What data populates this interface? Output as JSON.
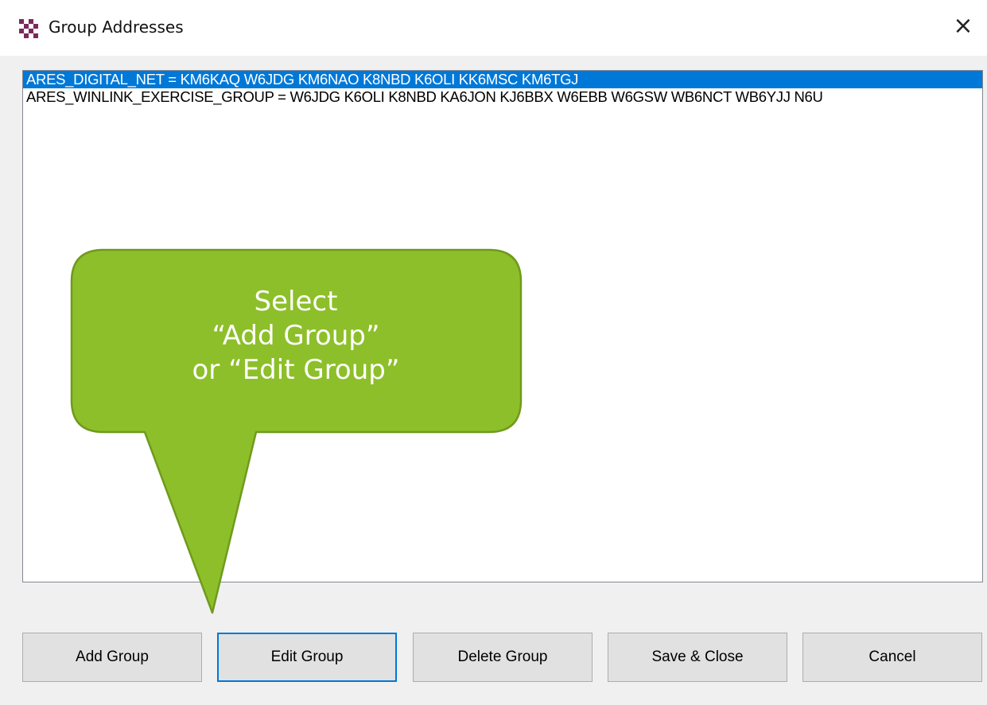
{
  "window": {
    "title": "Group Addresses",
    "close_glyph": "×",
    "icon": "checkered-app-icon"
  },
  "list": {
    "items": [
      {
        "text": "ARES_DIGITAL_NET = KM6KAQ W6JDG KM6NAO K8NBD K6OLI KK6MSC KM6TGJ",
        "selected": true
      },
      {
        "text": "ARES_WINLINK_EXERCISE_GROUP = W6JDG K6OLI K8NBD KA6JON KJ6BBX W6EBB W6GSW WB6NCT WB6YJJ N6U",
        "selected": false
      }
    ]
  },
  "buttons": {
    "add": "Add Group",
    "edit": "Edit Group",
    "delete": "Delete Group",
    "save": "Save & Close",
    "cancel": "Cancel"
  },
  "callout": {
    "line1": "Select",
    "line2": "“Add Group”",
    "line3": "or “Edit Group”",
    "fill": "#8dbf2a",
    "stroke": "#6f9a1d"
  },
  "colors": {
    "selection": "#0078d7",
    "focus_border": "#0078d7"
  }
}
